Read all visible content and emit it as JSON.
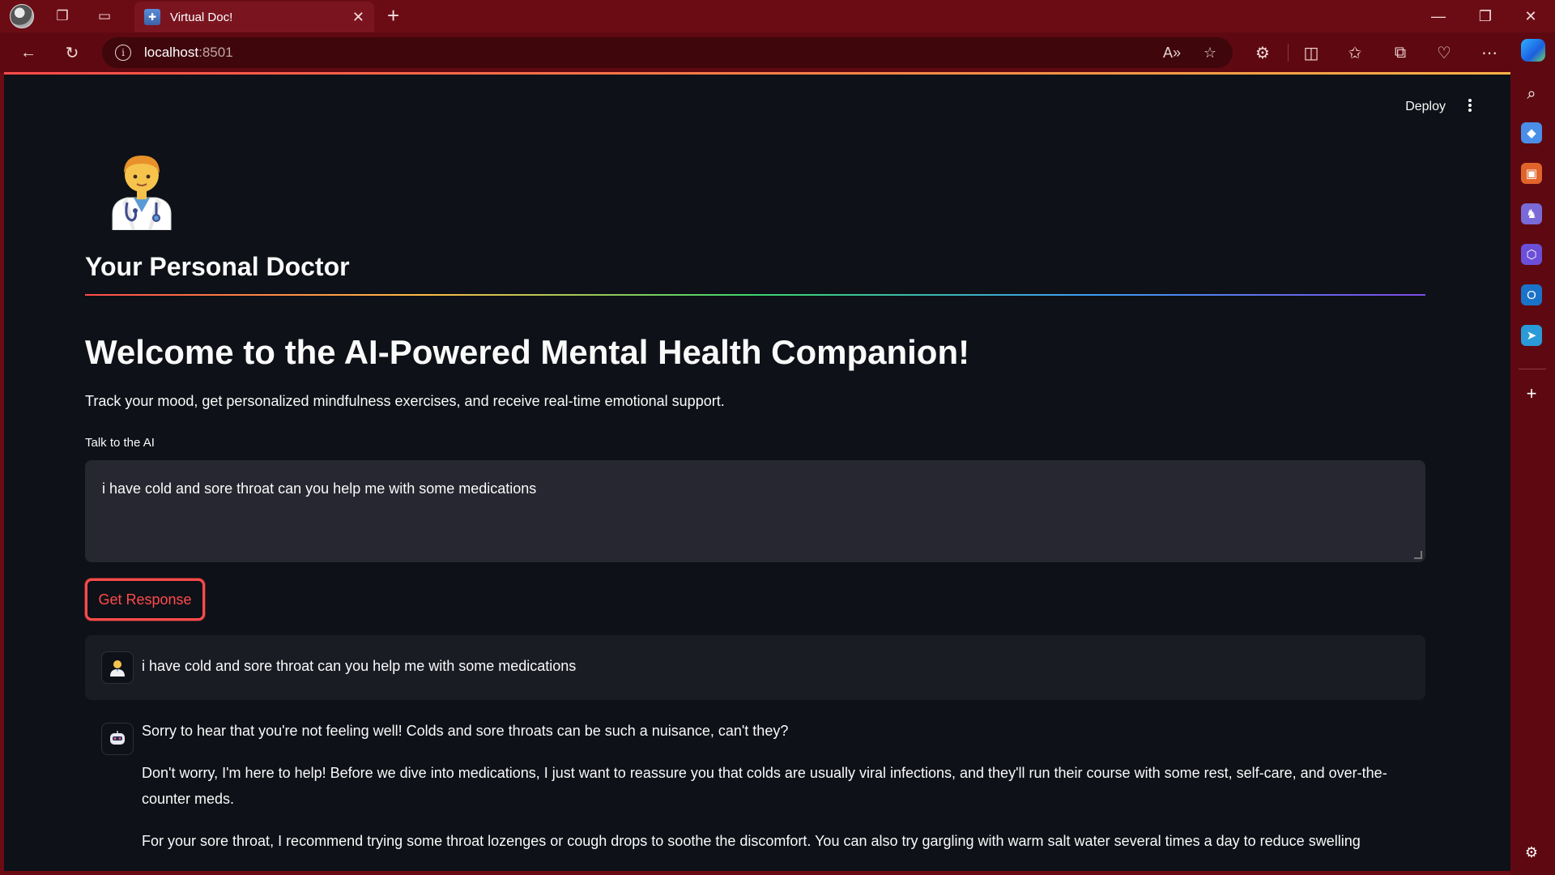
{
  "browser": {
    "tab_title": "Virtual Doc!",
    "url_host": "localhost",
    "url_port": ":8501",
    "tab_close": "✕",
    "new_tab": "+"
  },
  "app": {
    "deploy_label": "Deploy",
    "header_title": "Your Personal Doctor",
    "welcome_heading": "Welcome to the AI-Powered Mental Health Companion!",
    "subtitle": "Track your mood, get personalized mindfulness exercises, and receive real-time emotional support.",
    "input_label": "Talk to the AI",
    "input_value": "i have cold and sore throat can you help me with some medications",
    "button_label": "Get Response"
  },
  "chat": {
    "user_message": "i have cold and sore throat can you help me with some medications",
    "assistant_paragraphs": [
      "Sorry to hear that you're not feeling well! Colds and sore throats can be such a nuisance, can't they?",
      "Don't worry, I'm here to help! Before we dive into medications, I just want to reassure you that colds are usually viral infections, and they'll run their course with some rest, self-care, and over-the-counter meds.",
      "For your sore throat, I recommend trying some throat lozenges or cough drops to soothe the discomfort. You can also try gargling with warm salt water several times a day to reduce swelling"
    ]
  },
  "colors": {
    "accent": "#ff4b4b",
    "page_bg": "#0e1117",
    "browser_frame": "#6b0c15"
  }
}
